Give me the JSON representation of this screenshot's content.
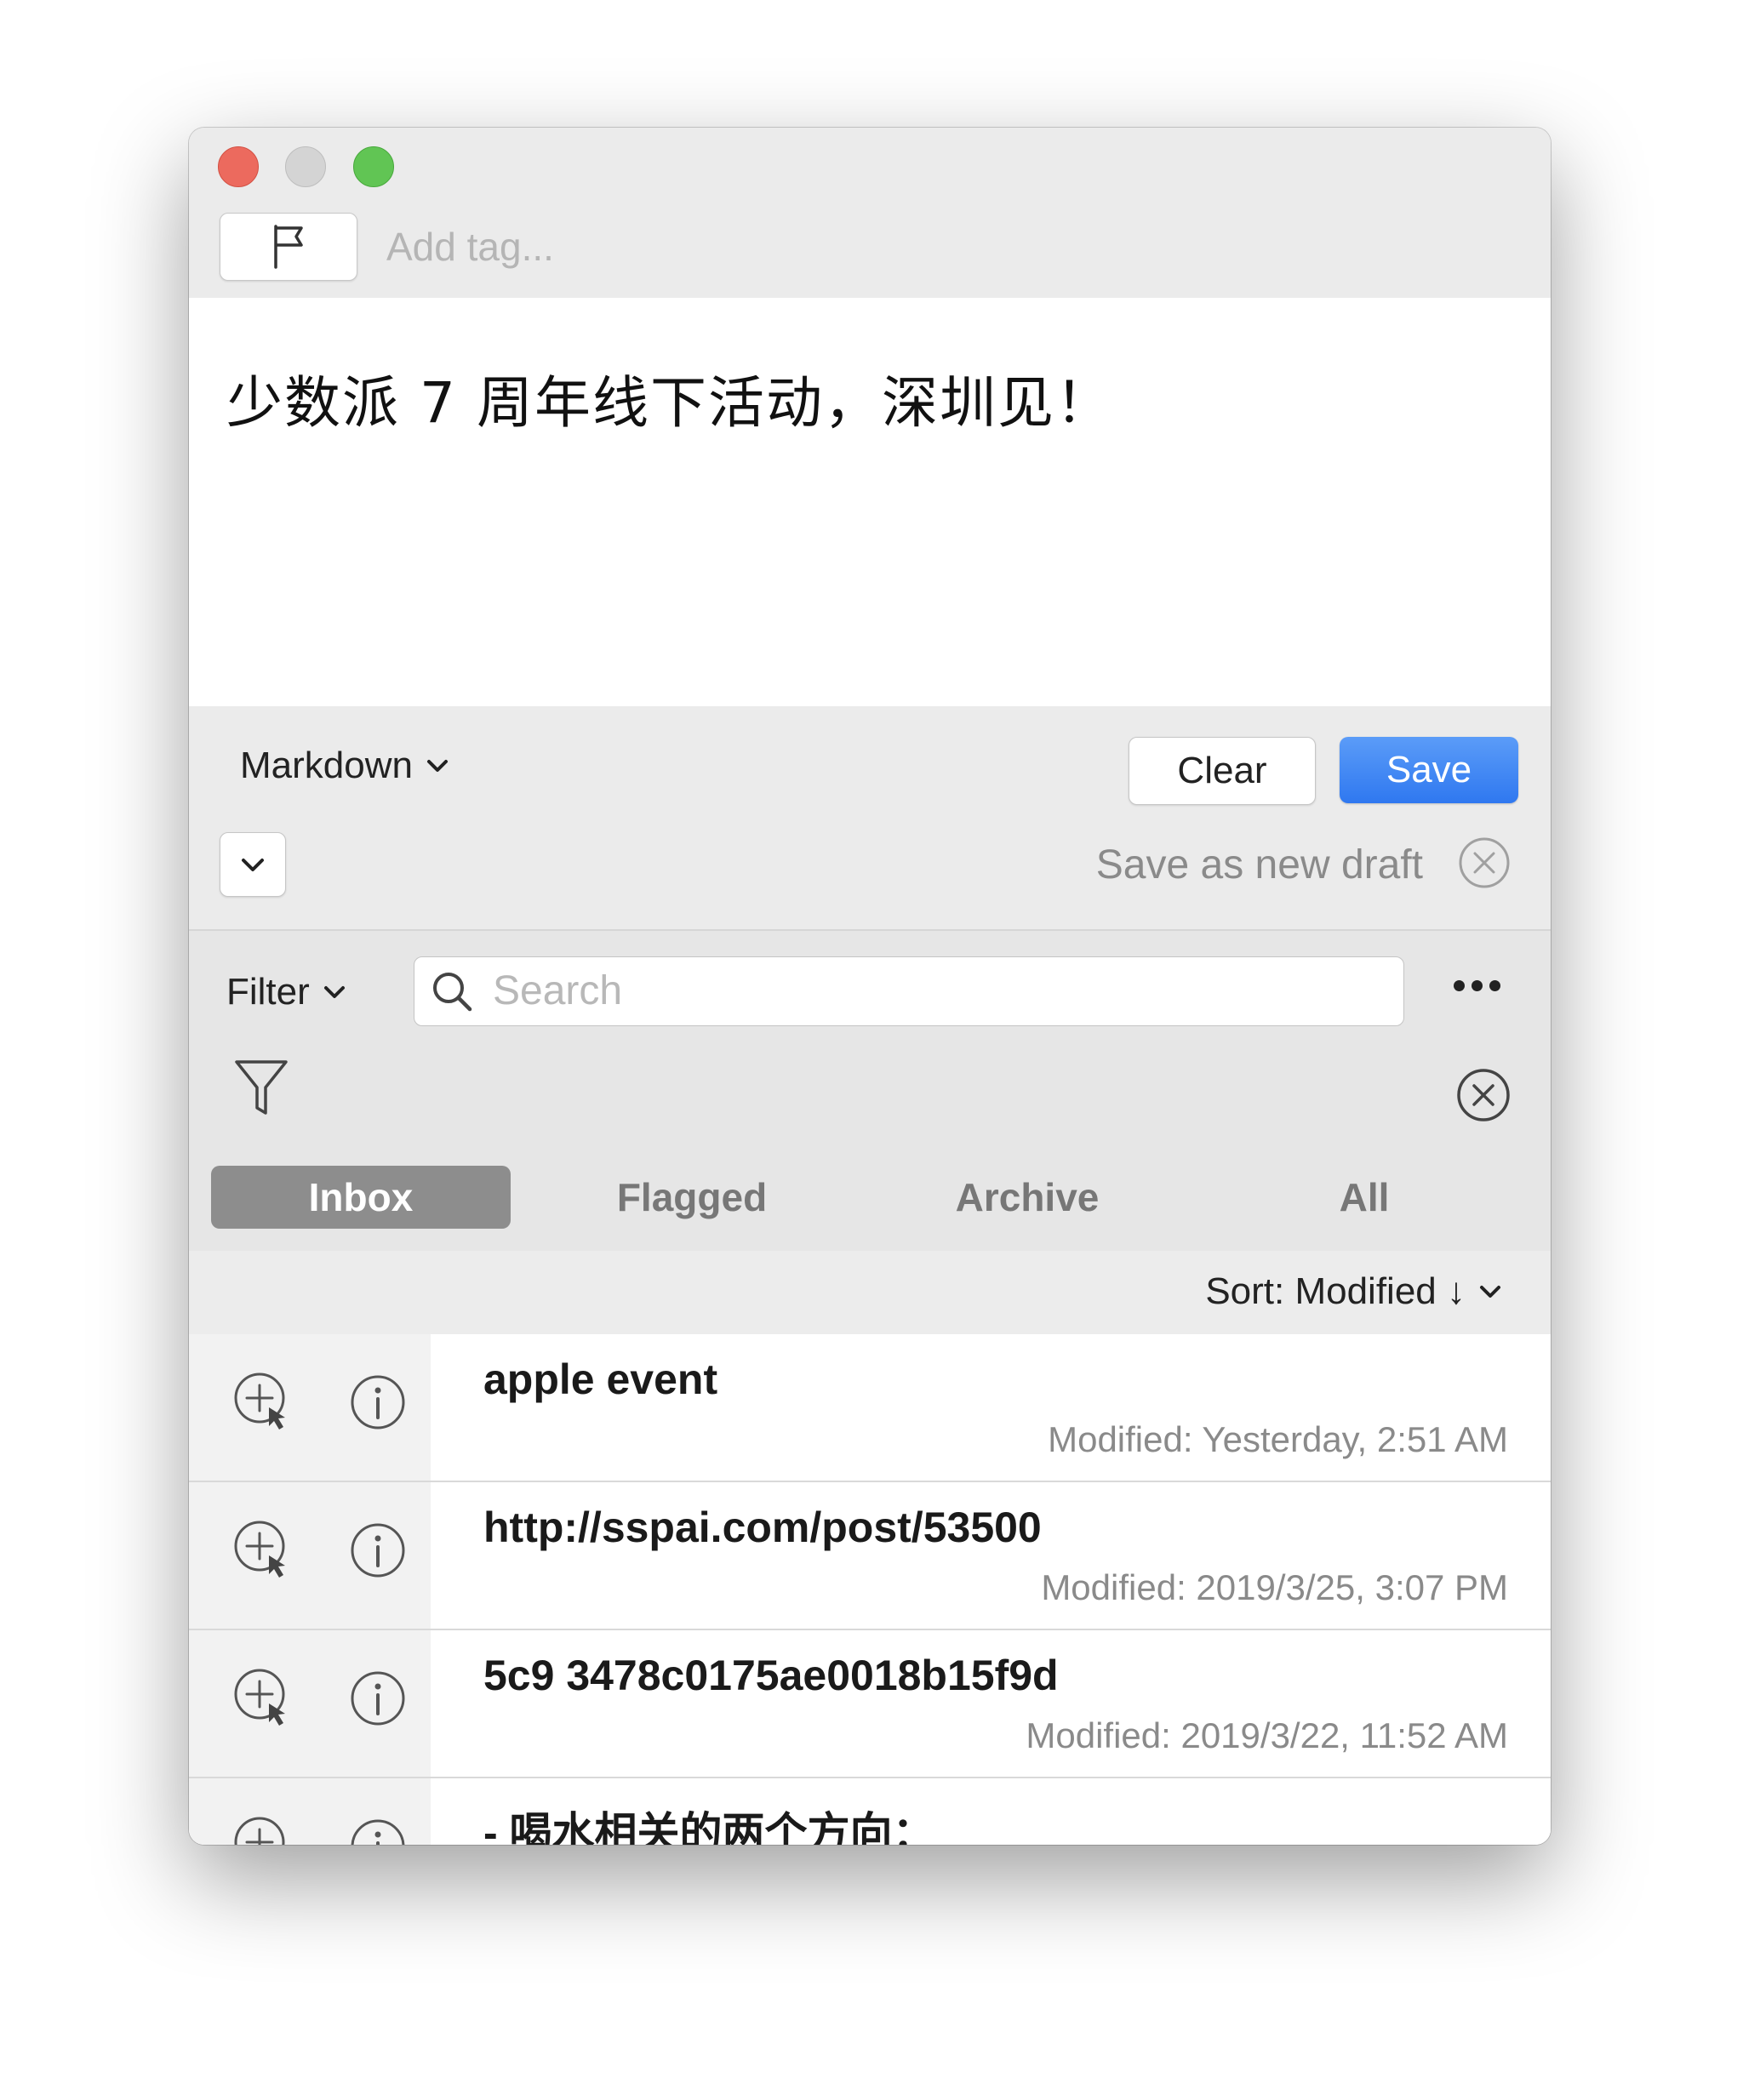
{
  "window": {
    "traffic_lights": [
      "close",
      "minimize",
      "zoom"
    ]
  },
  "toolbar": {
    "flag_icon": "flag-icon",
    "tag_placeholder": "Add tag..."
  },
  "editor": {
    "text": "少数派 7 周年线下活动，深圳见！"
  },
  "actions": {
    "format": "Markdown",
    "clear_label": "Clear",
    "save_label": "Save",
    "draft_label": "Save as new draft",
    "accent_color": "#2f78f0"
  },
  "filter": {
    "filter_label": "Filter",
    "search_placeholder": "Search",
    "tabs": [
      {
        "label": "Inbox",
        "active": true
      },
      {
        "label": "Flagged",
        "active": false
      },
      {
        "label": "Archive",
        "active": false
      },
      {
        "label": "All",
        "active": false
      }
    ]
  },
  "sort": {
    "label": "Sort: Modified ↓"
  },
  "list": {
    "items": [
      {
        "title": "apple event",
        "modified": "Modified: Yesterday, 2:51 AM"
      },
      {
        "title": "http://sspai.com/post/53500",
        "modified": "Modified: 2019/3/25, 3:07 PM"
      },
      {
        "title": "5c9 3478c0175ae0018b15f9d",
        "modified": "Modified: 2019/3/22, 11:52 AM"
      },
      {
        "title": "- 喝水相关的两个方向：",
        "modified": ""
      }
    ]
  }
}
